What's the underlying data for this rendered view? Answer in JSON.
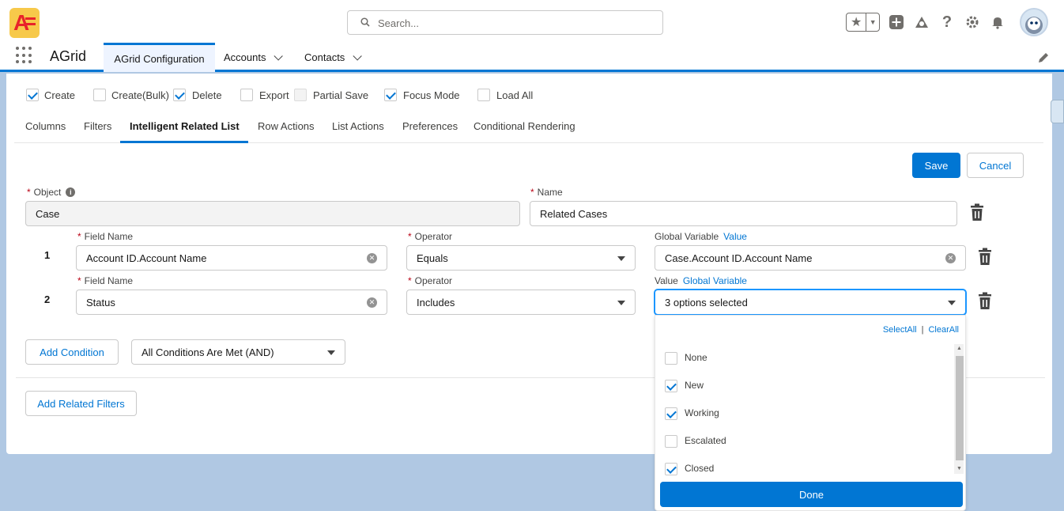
{
  "header": {
    "search_placeholder": "Search..."
  },
  "nav": {
    "app_name": "AGrid",
    "tabs": [
      {
        "label": "AGrid Configuration"
      },
      {
        "label": "Accounts"
      },
      {
        "label": "Contacts"
      }
    ]
  },
  "options": {
    "checkboxes": [
      {
        "label": "Create",
        "checked": true
      },
      {
        "label": "Create(Bulk)",
        "checked": false
      },
      {
        "label": "Delete",
        "checked": true
      },
      {
        "label": "Export",
        "checked": false
      },
      {
        "label": "Partial Save",
        "checked": false
      },
      {
        "label": "Focus Mode",
        "checked": true
      },
      {
        "label": "Load All",
        "checked": false
      }
    ]
  },
  "tabs": [
    {
      "label": "Columns"
    },
    {
      "label": "Filters"
    },
    {
      "label": "Intelligent Related List"
    },
    {
      "label": "Row Actions"
    },
    {
      "label": "List Actions"
    },
    {
      "label": "Preferences"
    },
    {
      "label": "Conditional Rendering"
    }
  ],
  "actions": {
    "save": "Save",
    "cancel": "Cancel"
  },
  "form": {
    "object_label": "Object",
    "object_value": "Case",
    "name_label": "Name",
    "name_value": "Related Cases",
    "required_mark": "*"
  },
  "conditions": [
    {
      "number": "1",
      "field_label": "Field Name",
      "field_value": "Account ID.Account Name",
      "operator_label": "Operator",
      "operator_value": "Equals",
      "value_label": "Global Variable",
      "value_toggle": "Value",
      "value_value": "Case.Account ID.Account Name"
    },
    {
      "number": "2",
      "field_label": "Field Name",
      "field_value": "Status",
      "operator_label": "Operator",
      "operator_value": "Includes",
      "value_label": "Value",
      "value_toggle": "Global Variable",
      "value_value": "3 options selected"
    }
  ],
  "footer": {
    "add_condition": "Add Condition",
    "logic": "All Conditions Are Met (AND)",
    "add_related_filters": "Add Related Filters"
  },
  "dropdown": {
    "select_all": "SelectAll",
    "separator": "|",
    "clear_all": "ClearAll",
    "options": [
      {
        "label": "None",
        "checked": false
      },
      {
        "label": "New",
        "checked": true
      },
      {
        "label": "Working",
        "checked": true
      },
      {
        "label": "Escalated",
        "checked": false
      },
      {
        "label": "Closed",
        "checked": true
      }
    ],
    "done": "Done"
  },
  "colors": {
    "brand": "#0176d3",
    "background": "#b0c8e3",
    "required": "#ba0517"
  }
}
